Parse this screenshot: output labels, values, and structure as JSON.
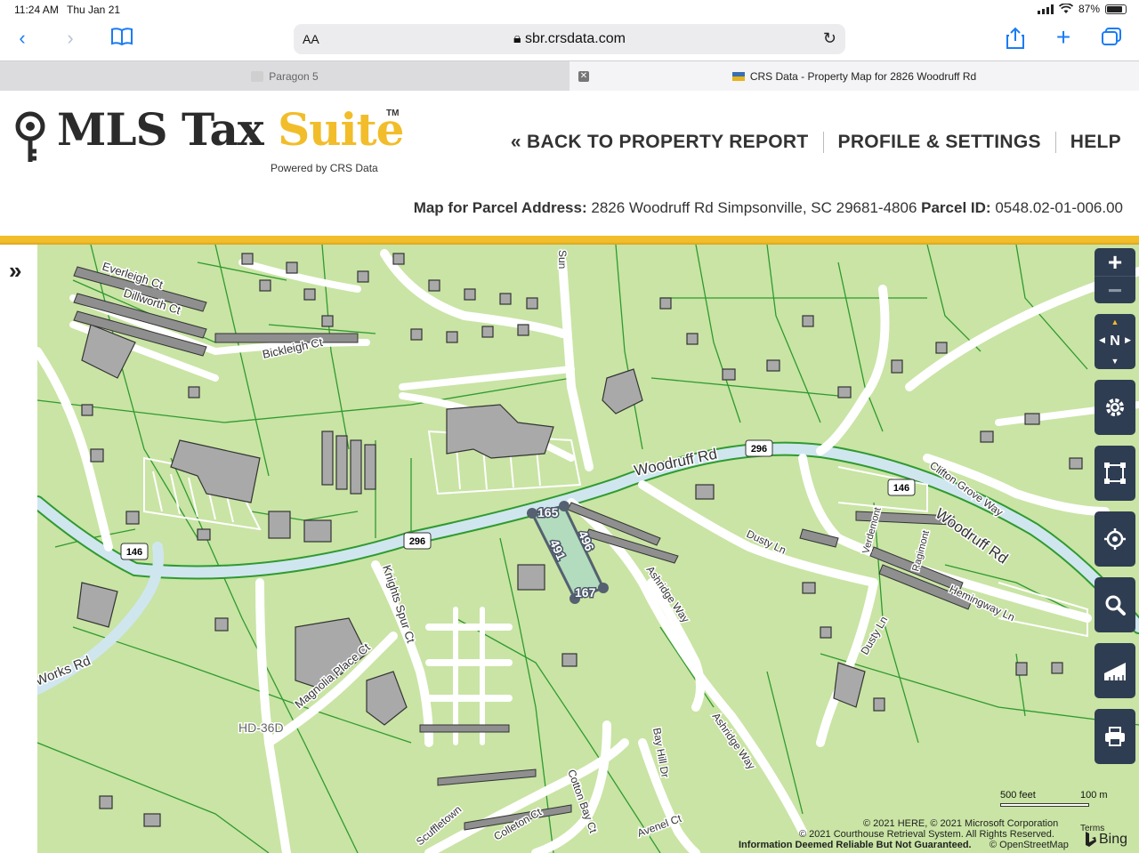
{
  "status": {
    "time": "11:24 AM",
    "date": "Thu Jan 21",
    "battery": "87%",
    "battery_level": 0.87
  },
  "browser": {
    "text_size": "AA",
    "url": "sbr.crsdata.com",
    "icons": [
      "back-icon",
      "forward-icon",
      "bookmarks-icon",
      "reload-icon",
      "share-icon",
      "new-tab-icon",
      "tabs-icon"
    ]
  },
  "tabs": [
    {
      "label": "Paragon 5",
      "active": false
    },
    {
      "label": "CRS Data - Property Map for 2826 Woodruff Rd",
      "active": true
    }
  ],
  "brand": {
    "name_a": "MLS Tax ",
    "name_b": "Suite",
    "tm": "TM",
    "powered": "Powered by CRS Data",
    "accent": "#f2bd2a",
    "dark": "#2b2b2b"
  },
  "nav": {
    "back": "« BACK TO PROPERTY REPORT",
    "profile": "PROFILE & SETTINGS",
    "help": "HELP"
  },
  "parcel": {
    "address_label": "Map for Parcel Address:",
    "address": "2826 Woodruff Rd Simpsonville, SC 29681-4806",
    "id_label": "Parcel ID:",
    "id": "0548.02-01-006.00"
  },
  "map": {
    "land_color": "#c9e4a4",
    "road_color": "#cfe6ef",
    "parcel_line_color": "#2f9a2f",
    "building_color": "#a9a9a9",
    "street_labels": [
      "Woodruff Rd",
      "Woodruff Rd",
      "Everleigh Ct",
      "Dillworth Ct",
      "Bickleigh Ct",
      "Knights Spur Ct",
      "Magnolia Place Ct",
      "Dusty Ln",
      "Dusty Ln",
      "Ashridge Way",
      "Ashridge Way",
      "Hemingway Ln",
      "Clifton Grove Way",
      "Verdemont",
      "Ragimont",
      "Bay Hill Dr",
      "Cotton Bay Ct",
      "Avenel Ct",
      "Colleton Ct",
      "Works Rd",
      "Sun",
      "Scuffletown",
      "HD-36D"
    ],
    "route_shields": [
      "296",
      "296",
      "146",
      "146"
    ],
    "parcel_dims": [
      "165",
      "496",
      "491",
      "167"
    ],
    "scale": {
      "feet": "500 feet",
      "meters": "100 m"
    },
    "attribution_1": "© 2021 HERE, © 2021 Microsoft Corporation",
    "terms": "Terms",
    "attribution_2": "© 2021 Courthouse Retrieval System. All Rights Reserved.",
    "attribution_3": "Information Deemed Reliable But Not Guaranteed.",
    "attribution_4": "© OpenStreetMap",
    "provider": "Bing"
  },
  "controls": {
    "zoom_in": "+",
    "zoom_out": "−",
    "compass": "N",
    "icons": [
      "settings-icon",
      "select-area-icon",
      "locate-icon",
      "search-icon",
      "measure-icon",
      "print-icon"
    ]
  },
  "sidebar": {
    "expand": "»"
  }
}
